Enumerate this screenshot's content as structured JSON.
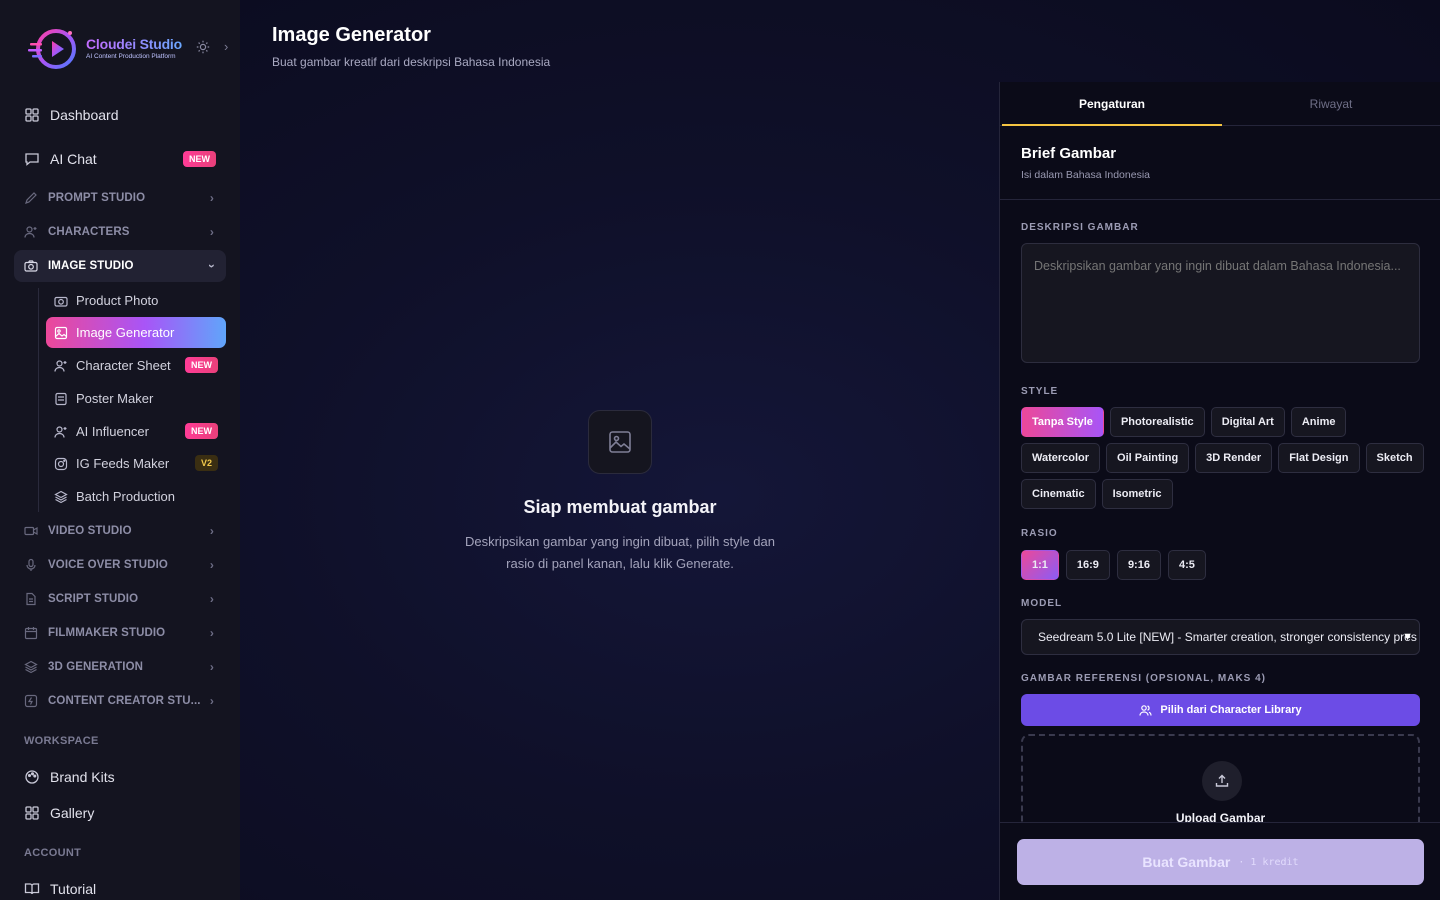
{
  "brand": {
    "name": "Cloudei Studio",
    "tagline": "AI Content Production Platform"
  },
  "sidebar": {
    "top_items": [
      {
        "label": "Dashboard",
        "icon": "grid-icon"
      },
      {
        "label": "AI Chat",
        "icon": "chat-icon",
        "badge": "NEW"
      }
    ],
    "sections": [
      {
        "label": "PROMPT STUDIO",
        "icon": "pen-icon"
      },
      {
        "label": "CHARACTERS",
        "icon": "user-plus-icon"
      },
      {
        "label": "IMAGE STUDIO",
        "icon": "camera-icon",
        "open": true
      },
      {
        "label": "VIDEO STUDIO",
        "icon": "video-icon"
      },
      {
        "label": "VOICE OVER STUDIO",
        "icon": "mic-icon"
      },
      {
        "label": "SCRIPT STUDIO",
        "icon": "file-icon"
      },
      {
        "label": "FILMMAKER STUDIO",
        "icon": "calendar-icon"
      },
      {
        "label": "3D GENERATION",
        "icon": "layers-icon"
      },
      {
        "label": "CONTENT CREATOR STU...",
        "icon": "bolt-icon"
      }
    ],
    "image_studio_items": [
      {
        "label": "Product Photo",
        "icon": "camera-icon"
      },
      {
        "label": "Image Generator",
        "icon": "image-icon",
        "active": true
      },
      {
        "label": "Character Sheet",
        "icon": "user-plus-icon",
        "badge": "NEW"
      },
      {
        "label": "Poster Maker",
        "icon": "poster-icon"
      },
      {
        "label": "AI Influencer",
        "icon": "user-plus-icon",
        "badge": "NEW"
      },
      {
        "label": "IG Feeds Maker",
        "icon": "instagram-icon",
        "badge": "V2"
      },
      {
        "label": "Batch Production",
        "icon": "layers-icon"
      }
    ],
    "workspace_label": "WORKSPACE",
    "workspace_items": [
      {
        "label": "Brand Kits",
        "icon": "palette-icon"
      },
      {
        "label": "Gallery",
        "icon": "grid-icon"
      }
    ],
    "account_label": "ACCOUNT",
    "account_items": [
      {
        "label": "Tutorial",
        "icon": "book-icon"
      }
    ]
  },
  "header": {
    "title": "Image Generator",
    "subtitle": "Buat gambar kreatif dari deskripsi Bahasa Indonesia"
  },
  "empty_state": {
    "title": "Siap membuat gambar",
    "description": "Deskripsikan gambar yang ingin dibuat, pilih style dan rasio di panel kanan, lalu klik Generate."
  },
  "panel": {
    "tabs": [
      "Pengaturan",
      "Riwayat"
    ],
    "active_tab": "Pengaturan",
    "title": "Brief Gambar",
    "subtitle": "Isi dalam Bahasa Indonesia",
    "description_label": "DESKRIPSI GAMBAR",
    "description_placeholder": "Deskripsikan gambar yang ingin dibuat dalam Bahasa Indonesia...",
    "style_label": "STYLE",
    "styles": [
      "Tanpa Style",
      "Photorealistic",
      "Digital Art",
      "Anime",
      "Watercolor",
      "Oil Painting",
      "3D Render",
      "Flat Design",
      "Sketch",
      "Cinematic",
      "Isometric"
    ],
    "selected_style": "Tanpa Style",
    "ratio_label": "RASIO",
    "ratios": [
      "1:1",
      "16:9",
      "9:16",
      "4:5"
    ],
    "selected_ratio": "1:1",
    "model_label": "MODEL",
    "model_value": "Seedream 5.0 Lite [NEW] - Smarter creation, stronger consistency pres",
    "reference_label": "GAMBAR REFERENSI (OPSIONAL, MAKS 4)",
    "library_button": "Pilih dari Character Library",
    "upload_label": "Upload Gambar",
    "generate_button": "Buat Gambar",
    "generate_credit": "· 1 kredit"
  },
  "colors": {
    "accent_pink": "#ec4899",
    "accent_purple": "#a855f7",
    "library_button": "#6c4ce6",
    "tab_underline": "#f5c542"
  }
}
